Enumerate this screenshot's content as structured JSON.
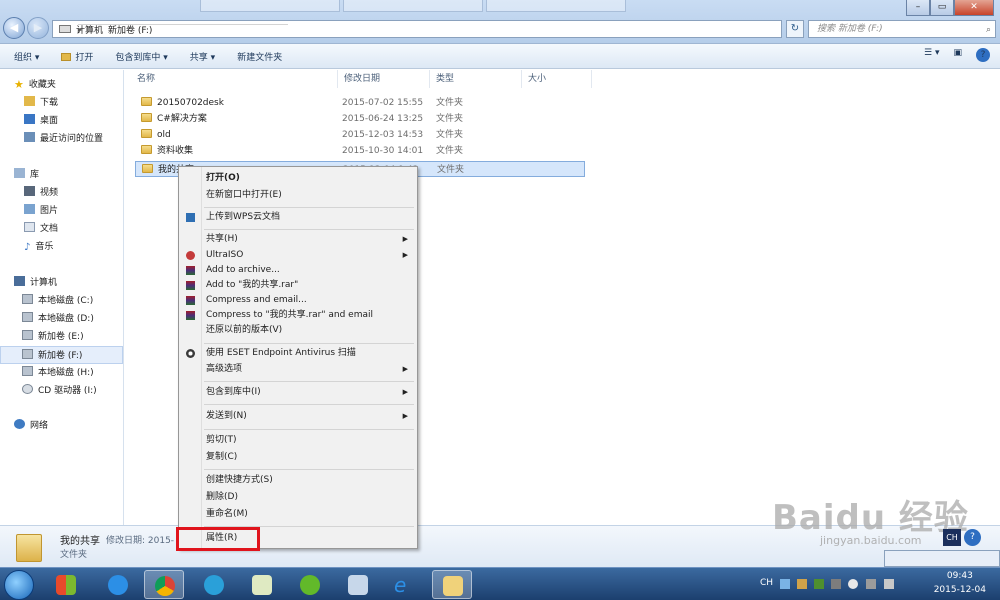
{
  "address": {
    "crumbs": [
      "计算机",
      "新加卷 (F:)"
    ],
    "search_placeholder": "搜索 新加卷 (F:)"
  },
  "toolbar": {
    "organize": "组织 ▾",
    "open": "打开",
    "include_in_library": "包含到库中 ▾",
    "share": "共享 ▾",
    "new_folder": "新建文件夹"
  },
  "sidebar": {
    "favorites": "收藏夹",
    "downloads": "下载",
    "desktop": "桌面",
    "recent": "最近访问的位置",
    "libraries": "库",
    "videos": "视频",
    "pictures": "图片",
    "documents": "文档",
    "music": "音乐",
    "computer": "计算机",
    "drives": [
      "本地磁盘 (C:)",
      "本地磁盘 (D:)",
      "新加卷 (E:)",
      "新加卷 (F:)",
      "本地磁盘 (H:)",
      "CD 驱动器 (I:)"
    ],
    "network": "网络"
  },
  "columns": {
    "name": "名称",
    "date": "修改日期",
    "type": "类型",
    "size": "大小"
  },
  "files": [
    {
      "name": "20150702desk",
      "date": "2015-07-02 15:55",
      "type": "文件夹"
    },
    {
      "name": "C#解决方案",
      "date": "2015-06-24 13:25",
      "type": "文件夹"
    },
    {
      "name": "old",
      "date": "2015-12-03 14:53",
      "type": "文件夹"
    },
    {
      "name": "资料收集",
      "date": "2015-10-30 14:01",
      "type": "文件夹"
    },
    {
      "name": "我的共享",
      "date": "2015-12-04 9:43",
      "type": "文件夹"
    }
  ],
  "context_menu": {
    "open": "打开(O)",
    "open_new_window": "在新窗口中打开(E)",
    "upload_wps": "上传到WPS云文档",
    "share": "共享(H)",
    "ultraiso": "UltraISO",
    "add_archive": "Add to archive...",
    "add_rar": "Add to \"我的共享.rar\"",
    "compress_email": "Compress and email...",
    "compress_rar_email": "Compress to \"我的共享.rar\" and email",
    "restore": "还原以前的版本(V)",
    "eset": "使用 ESET Endpoint Antivirus 扫描",
    "advanced": "高级选项",
    "include_library": "包含到库中(I)",
    "send_to": "发送到(N)",
    "cut": "剪切(T)",
    "copy": "复制(C)",
    "create_shortcut": "创建快捷方式(S)",
    "delete": "删除(D)",
    "rename": "重命名(M)",
    "properties": "属性(R)"
  },
  "details": {
    "name": "我的共享",
    "modified_label": "修改日期: 2015-",
    "type": "文件夹"
  },
  "tray": {
    "lang": "CH",
    "time": "09:43",
    "date": "2015-12-04"
  },
  "watermark": {
    "logo": "Baidu 经验",
    "url": "jingyan.baidu.com"
  }
}
